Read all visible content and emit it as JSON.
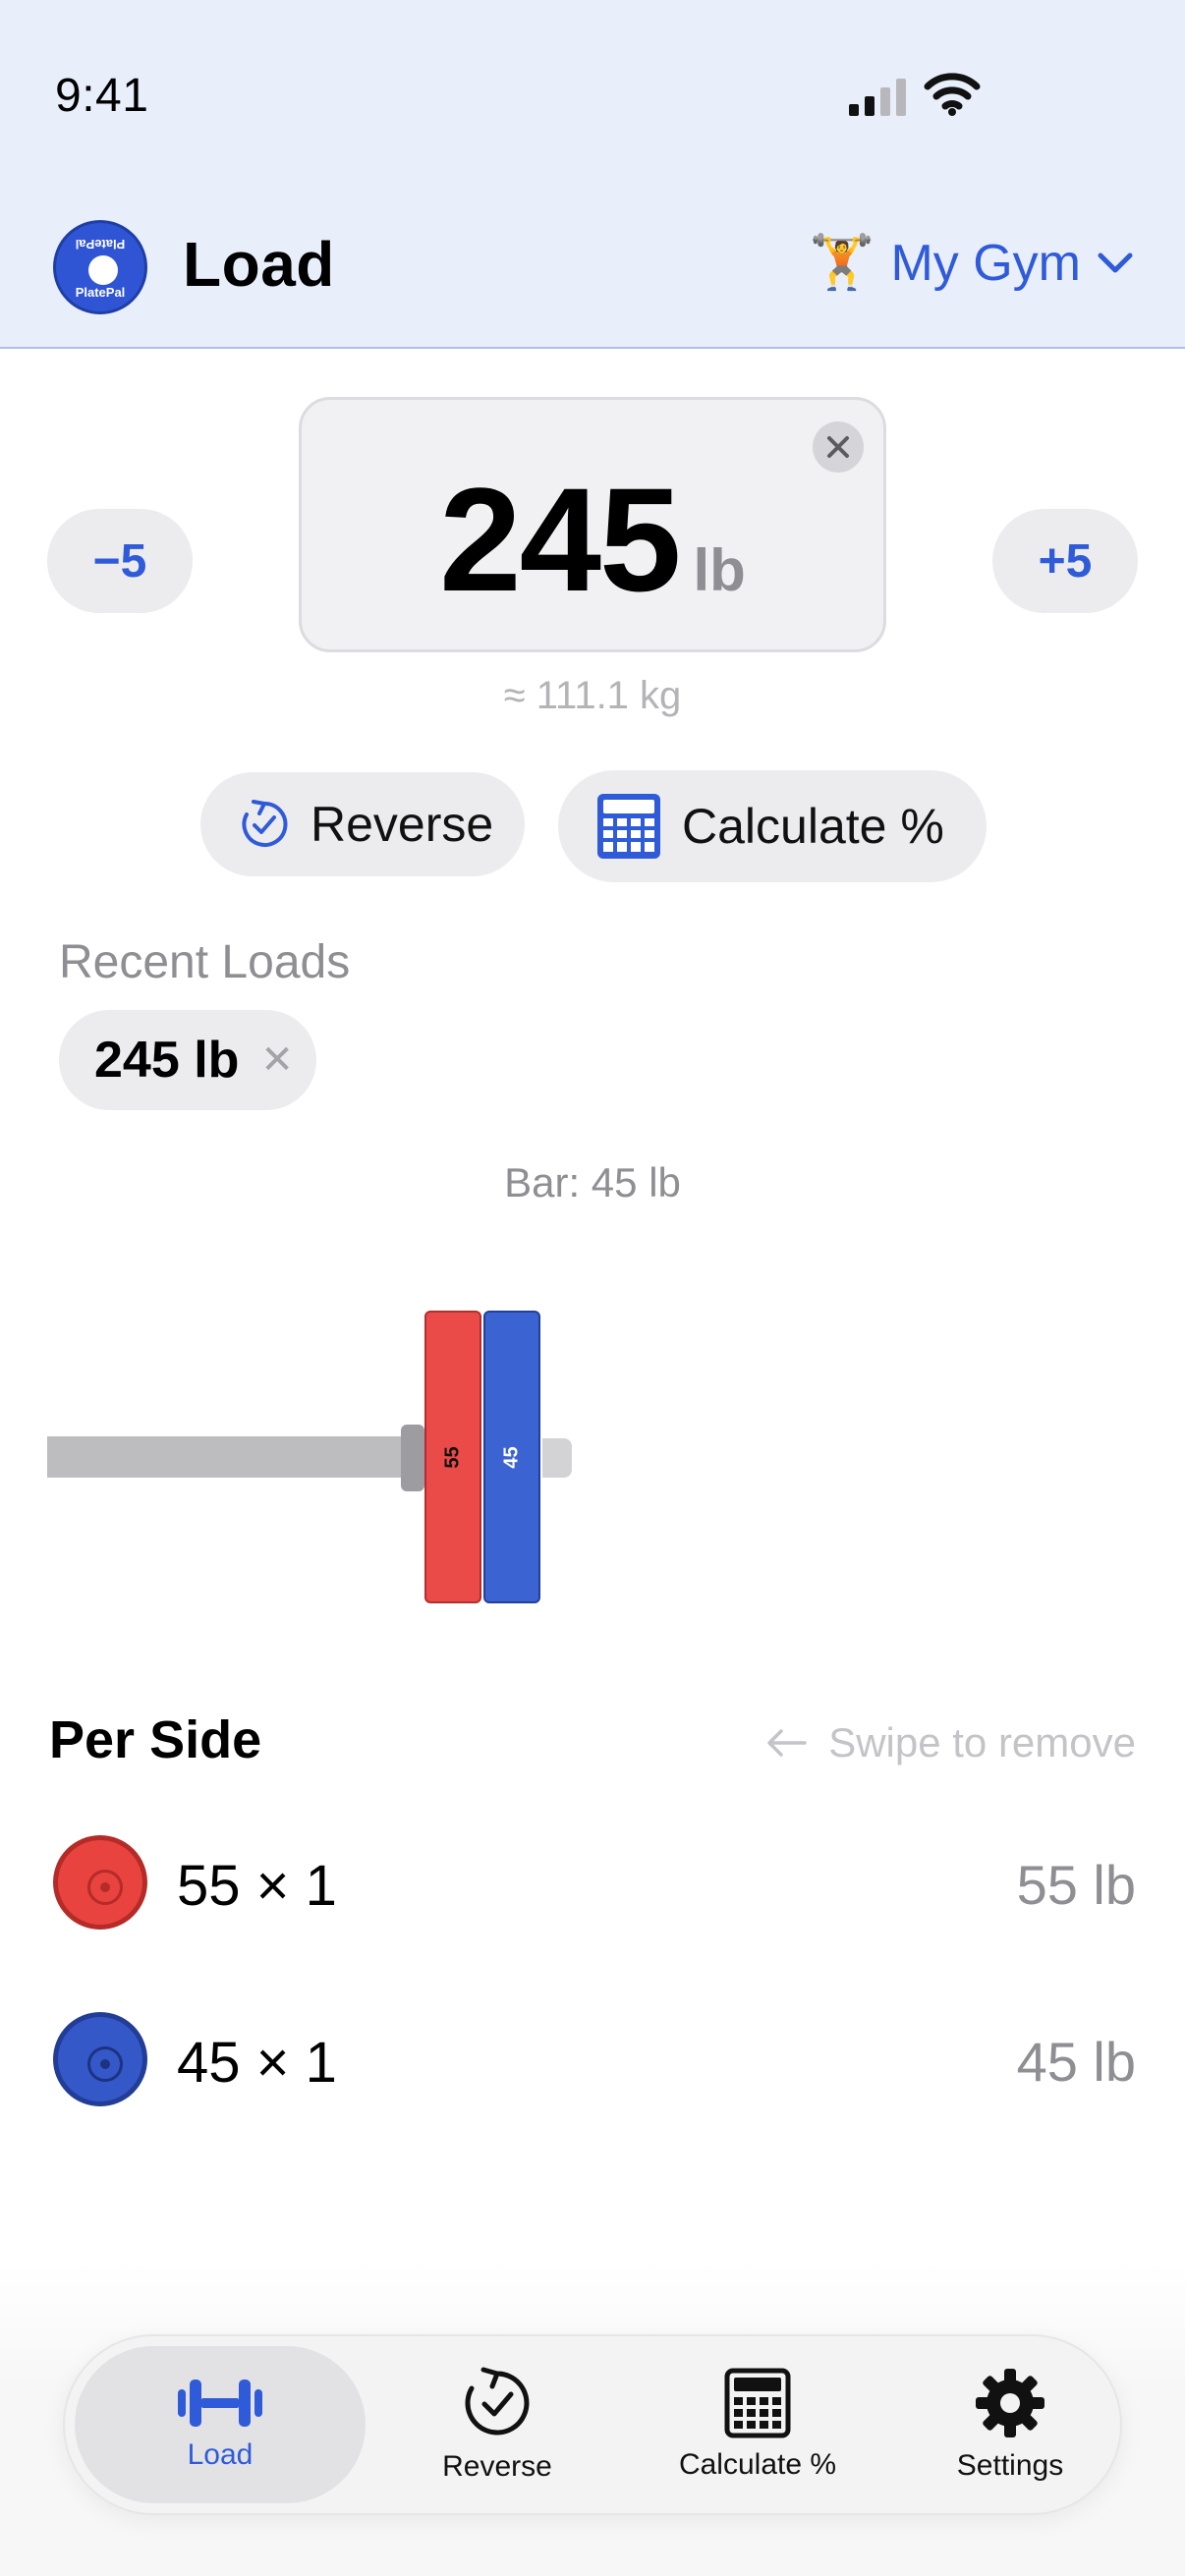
{
  "status_bar": {
    "time": "9:41"
  },
  "header": {
    "logo_text": "PlatePal",
    "title": "Load",
    "gym_emoji": "🏋️",
    "gym_name": "My Gym"
  },
  "weight": {
    "value": "245",
    "unit": "lb",
    "minus_label": "−5",
    "plus_label": "+5",
    "kg_equivalent": "≈ 111.1 kg"
  },
  "actions": {
    "reverse_label": "Reverse",
    "calculate_label": "Calculate %"
  },
  "recent": {
    "title": "Recent Loads",
    "items": [
      {
        "label": "245 lb"
      }
    ]
  },
  "bar_caption": "Bar: 45 lb",
  "barbell": {
    "plates": [
      {
        "label": "55",
        "color": "#ea4a48"
      },
      {
        "label": "45",
        "color": "#3b63d2"
      }
    ]
  },
  "per_side": {
    "title": "Per Side",
    "hint": "Swipe to remove",
    "rows": [
      {
        "desc": "55 × 1",
        "total": "55 lb",
        "color": "#e8433f"
      },
      {
        "desc": "45 × 1",
        "total": "45 lb",
        "color": "#3558c9"
      }
    ]
  },
  "tabs": [
    {
      "label": "Load",
      "icon": "barbell-icon",
      "active": true
    },
    {
      "label": "Reverse",
      "icon": "reverse-check-icon",
      "active": false
    },
    {
      "label": "Calculate %",
      "icon": "calculator-icon",
      "active": false
    },
    {
      "label": "Settings",
      "icon": "gear-icon",
      "active": false
    }
  ],
  "colors": {
    "accent": "#2f5bd8",
    "header_bg": "#e9eefb",
    "plate_red": "#ea4a48",
    "plate_blue": "#3b63d2"
  }
}
